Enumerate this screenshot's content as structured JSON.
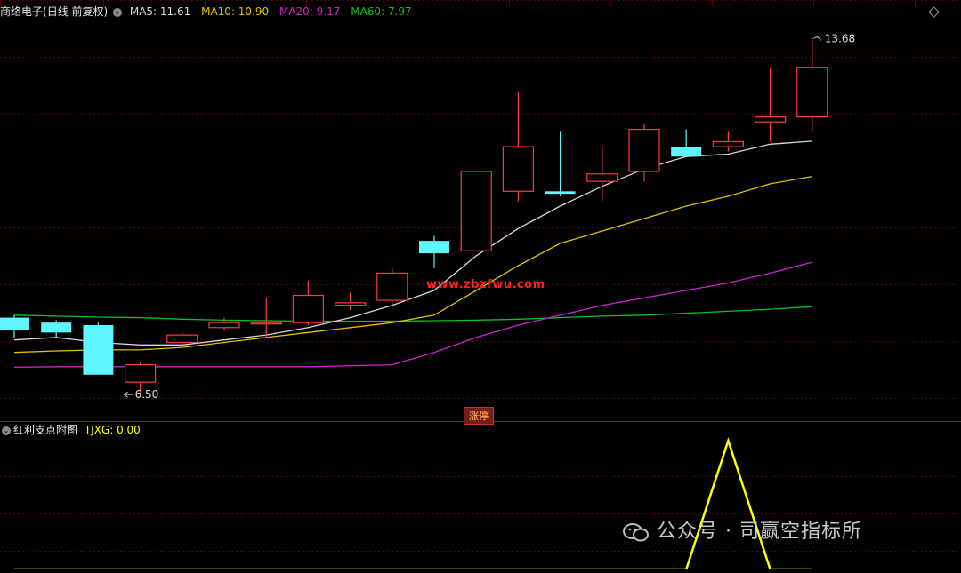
{
  "header": {
    "stock_name": "商络电子",
    "period": "(日线 前复权)",
    "ma5_label": "MA5: 11.61",
    "ma10_label": "MA10: 10.90",
    "ma20_label": "MA20: 9.17",
    "ma60_label": "MA60: 7.97"
  },
  "sub_header": {
    "indicator_name": "红利支点附图",
    "tjxg_label": "TJXG: 0.00"
  },
  "annotations": {
    "high_label": "13.68",
    "low_label": "6.50",
    "zhangting_badge": "涨停",
    "url_watermark": "www.zbzfwu.com"
  },
  "watermark": {
    "text": "公众号 · 司赢空指标所"
  },
  "colors": {
    "up": "#ff3b3b",
    "down": "#5ff7ff",
    "ma5": "#d8d8d8",
    "ma10": "#e0c000",
    "ma20": "#d020d0",
    "ma60": "#10c020",
    "grid": "#5a0000",
    "tjxg": "#ffff00"
  },
  "chart_data": {
    "type": "candlestick",
    "ylim": [
      6.0,
      14.1
    ],
    "candles": [
      {
        "o": 8.05,
        "c": 7.8,
        "h": 8.1,
        "l": 7.65
      },
      {
        "o": 7.95,
        "c": 7.75,
        "h": 8.0,
        "l": 7.65
      },
      {
        "o": 7.9,
        "c": 6.9,
        "h": 7.95,
        "l": 6.9
      },
      {
        "o": 6.75,
        "c": 7.1,
        "h": 7.15,
        "l": 6.5
      },
      {
        "o": 7.55,
        "c": 7.7,
        "h": 7.75,
        "l": 7.5
      },
      {
        "o": 7.85,
        "c": 7.95,
        "h": 8.05,
        "l": 7.8
      },
      {
        "o": 7.95,
        "c": 7.95,
        "h": 8.45,
        "l": 7.65
      },
      {
        "o": 7.95,
        "c": 8.5,
        "h": 8.8,
        "l": 7.9
      },
      {
        "o": 8.3,
        "c": 8.35,
        "h": 8.55,
        "l": 8.2
      },
      {
        "o": 8.4,
        "c": 8.95,
        "h": 9.05,
        "l": 8.3
      },
      {
        "o": 9.6,
        "c": 9.35,
        "h": 9.7,
        "l": 9.05
      },
      {
        "o": 9.4,
        "c": 11.0,
        "h": 11.0,
        "l": 9.4
      },
      {
        "o": 10.6,
        "c": 11.5,
        "h": 12.6,
        "l": 10.4
      },
      {
        "o": 10.6,
        "c": 10.55,
        "h": 11.8,
        "l": 10.5
      },
      {
        "o": 10.8,
        "c": 10.95,
        "h": 11.5,
        "l": 10.4
      },
      {
        "o": 11.0,
        "c": 11.85,
        "h": 11.95,
        "l": 10.8
      },
      {
        "o": 11.5,
        "c": 11.3,
        "h": 11.85,
        "l": 11.3
      },
      {
        "o": 11.5,
        "c": 11.6,
        "h": 11.8,
        "l": 11.4
      },
      {
        "o": 12.0,
        "c": 12.1,
        "h": 13.1,
        "l": 11.6
      },
      {
        "o": 12.1,
        "c": 13.1,
        "h": 13.68,
        "l": 11.8
      }
    ],
    "ma5": [
      7.6,
      7.65,
      7.55,
      7.5,
      7.5,
      7.6,
      7.7,
      7.85,
      8.05,
      8.3,
      8.6,
      9.3,
      9.85,
      10.3,
      10.7,
      11.05,
      11.3,
      11.35,
      11.55,
      11.61
    ],
    "ma10": [
      7.35,
      7.38,
      7.4,
      7.4,
      7.45,
      7.55,
      7.65,
      7.75,
      7.85,
      7.95,
      8.1,
      8.6,
      9.1,
      9.55,
      9.8,
      10.05,
      10.3,
      10.5,
      10.75,
      10.9
    ],
    "ma20": [
      7.05,
      7.06,
      7.06,
      7.06,
      7.06,
      7.06,
      7.06,
      7.06,
      7.08,
      7.1,
      7.35,
      7.65,
      7.9,
      8.1,
      8.3,
      8.45,
      8.6,
      8.75,
      8.95,
      9.17
    ],
    "ma60": [
      8.1,
      8.08,
      8.06,
      8.05,
      8.02,
      8.0,
      7.99,
      7.98,
      7.98,
      7.98,
      7.99,
      8.0,
      8.02,
      8.05,
      8.08,
      8.1,
      8.14,
      8.18,
      8.22,
      8.27
    ],
    "tjxg": [
      0,
      0,
      0,
      0,
      0,
      0,
      0,
      0,
      0,
      0,
      0,
      0,
      0,
      0,
      0,
      0,
      0,
      1,
      0,
      0
    ]
  }
}
